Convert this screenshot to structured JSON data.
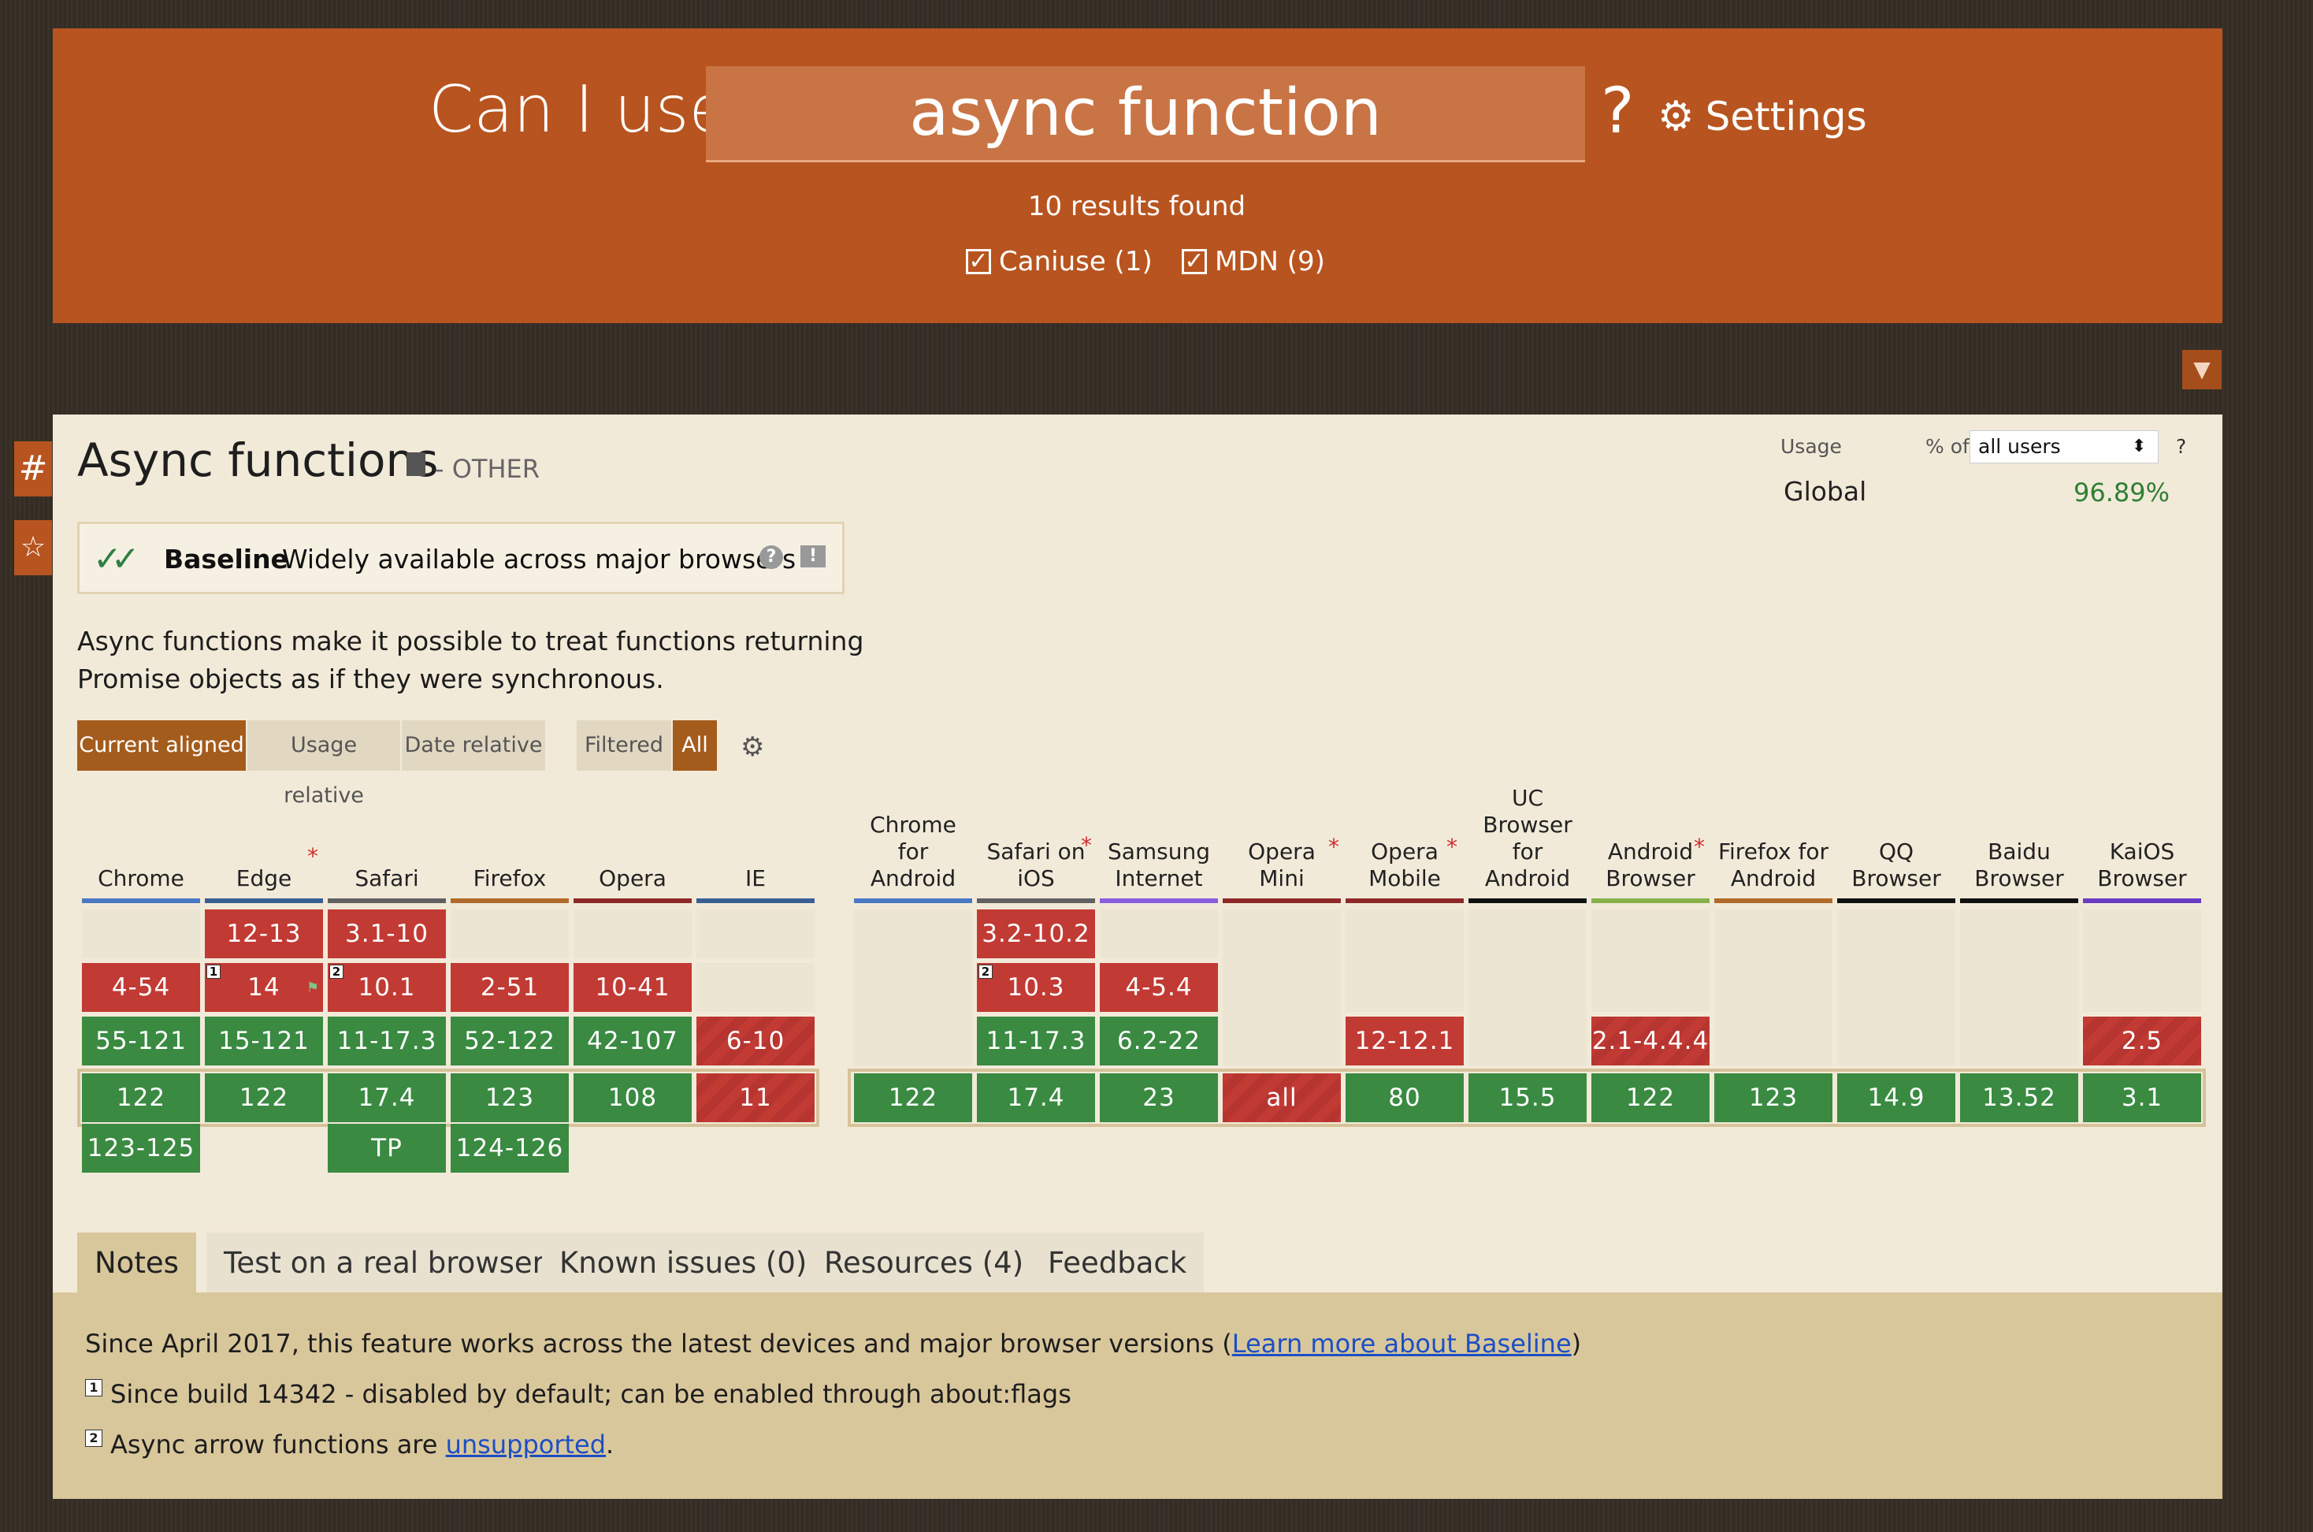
{
  "header": {
    "prefix": "Can I use",
    "query": "async function",
    "help": "?",
    "settings_label": "Settings",
    "results": "10 results found",
    "filters": [
      {
        "label": "Caniuse (1)",
        "checked": true
      },
      {
        "label": "MDN (9)",
        "checked": true
      }
    ]
  },
  "feature": {
    "title": "Async functions",
    "category": "- OTHER",
    "baseline_label": "Baseline",
    "baseline_text": "Widely available across major browsers",
    "baseline_help": "?",
    "baseline_feedback": "!",
    "description": "Async functions make it possible to treat functions returning Promise objects as if they were synchronous."
  },
  "anchors": {
    "hash": "#",
    "star": "☆"
  },
  "view_buttons": {
    "current_aligned": "Current aligned",
    "usage_relative": "Usage relative",
    "date_relative": "Date relative",
    "filtered": "Filtered",
    "all": "All"
  },
  "usage": {
    "label": "Usage",
    "pct_of": "% of",
    "select_value": "all users",
    "help": "?",
    "region": "Global",
    "value": "96.89%"
  },
  "browsers": [
    {
      "name": "Chrome",
      "bar": "#4a78c2",
      "star": false
    },
    {
      "name": "Edge",
      "bar": "#3a5f95",
      "star": true
    },
    {
      "name": "Safari",
      "bar": "#616161",
      "star": false
    },
    {
      "name": "Firefox",
      "bar": "#b06a2a",
      "star": false
    },
    {
      "name": "Opera",
      "bar": "#8f2a2a",
      "star": false
    },
    {
      "name": "IE",
      "bar": "#3a5f95",
      "star": false
    },
    {
      "name": "Chrome for Android",
      "bar": "#4a78c2",
      "star": false
    },
    {
      "name": "Safari on iOS",
      "bar": "#616161",
      "star": true
    },
    {
      "name": "Samsung Internet",
      "bar": "#8a5ee0",
      "star": false
    },
    {
      "name": "Opera Mini",
      "bar": "#8f2a2a",
      "star": true
    },
    {
      "name": "Opera Mobile",
      "bar": "#8f2a2a",
      "star": true
    },
    {
      "name": "UC Browser for Android",
      "bar": "#111111",
      "star": false
    },
    {
      "name": "Android Browser",
      "bar": "#86b24a",
      "star": true
    },
    {
      "name": "Firefox for Android",
      "bar": "#b06a2a",
      "star": false
    },
    {
      "name": "QQ Browser",
      "bar": "#111111",
      "star": false
    },
    {
      "name": "Baidu Browser",
      "bar": "#111111",
      "star": false
    },
    {
      "name": "KaiOS Browser",
      "bar": "#6a3cc2",
      "star": false
    }
  ],
  "support": {
    "chrome": [
      "",
      "4-54",
      "55-121",
      "122",
      "123-125"
    ],
    "edge": [
      "12-13",
      "14",
      "15-121",
      "122",
      ""
    ],
    "safari": [
      "3.1-10",
      "10.1",
      "11-17.3",
      "17.4",
      "TP"
    ],
    "firefox": [
      "",
      "2-51",
      "52-122",
      "123",
      "124-126"
    ],
    "opera": [
      "",
      "10-41",
      "42-107",
      "108",
      ""
    ],
    "ie": [
      "",
      "",
      "6-10",
      "11",
      ""
    ],
    "chrome_android": "122",
    "safari_ios": [
      "3.2-10.2",
      "10.3",
      "11-17.3",
      "17.4"
    ],
    "samsung": [
      "4-5.4",
      "6.2-22",
      "23"
    ],
    "opera_mini": "all",
    "opera_mobile": [
      "12-12.1",
      "80"
    ],
    "uc": "15.5",
    "android": [
      "2.1-4.4.4",
      "122"
    ],
    "firefox_android": "123",
    "qq": "14.9",
    "baidu": "13.52",
    "kaios": [
      "2.5",
      "3.1"
    ],
    "note_1": "1",
    "note_2": "2"
  },
  "tabs": [
    "Notes",
    "Test on a real browser",
    "Known issues (0)",
    "Resources (4)",
    "Feedback"
  ],
  "notes": {
    "baseline_prefix": "Since April 2017, this feature works across the latest devices and major browser versions (",
    "baseline_link": "Learn more about Baseline",
    "baseline_suffix": ")",
    "note1_num": "1",
    "note1_text": "Since build 14342 - disabled by default; can be enabled through about:flags",
    "note2_num": "2",
    "note2_prefix": "Async arrow functions are ",
    "note2_link": "unsupported",
    "note2_suffix": "."
  },
  "colors": {
    "header": "#b8541f",
    "supported": "#3a8a42",
    "unsupported": "#c23a34",
    "panel": "#f2ead9",
    "notes_bg": "#d9c79c"
  },
  "icons": {
    "settings": "gear-icon",
    "filter": "filter-icon",
    "category": "document-icon",
    "baseline": "double-check-icon",
    "flag": "flag-icon"
  }
}
